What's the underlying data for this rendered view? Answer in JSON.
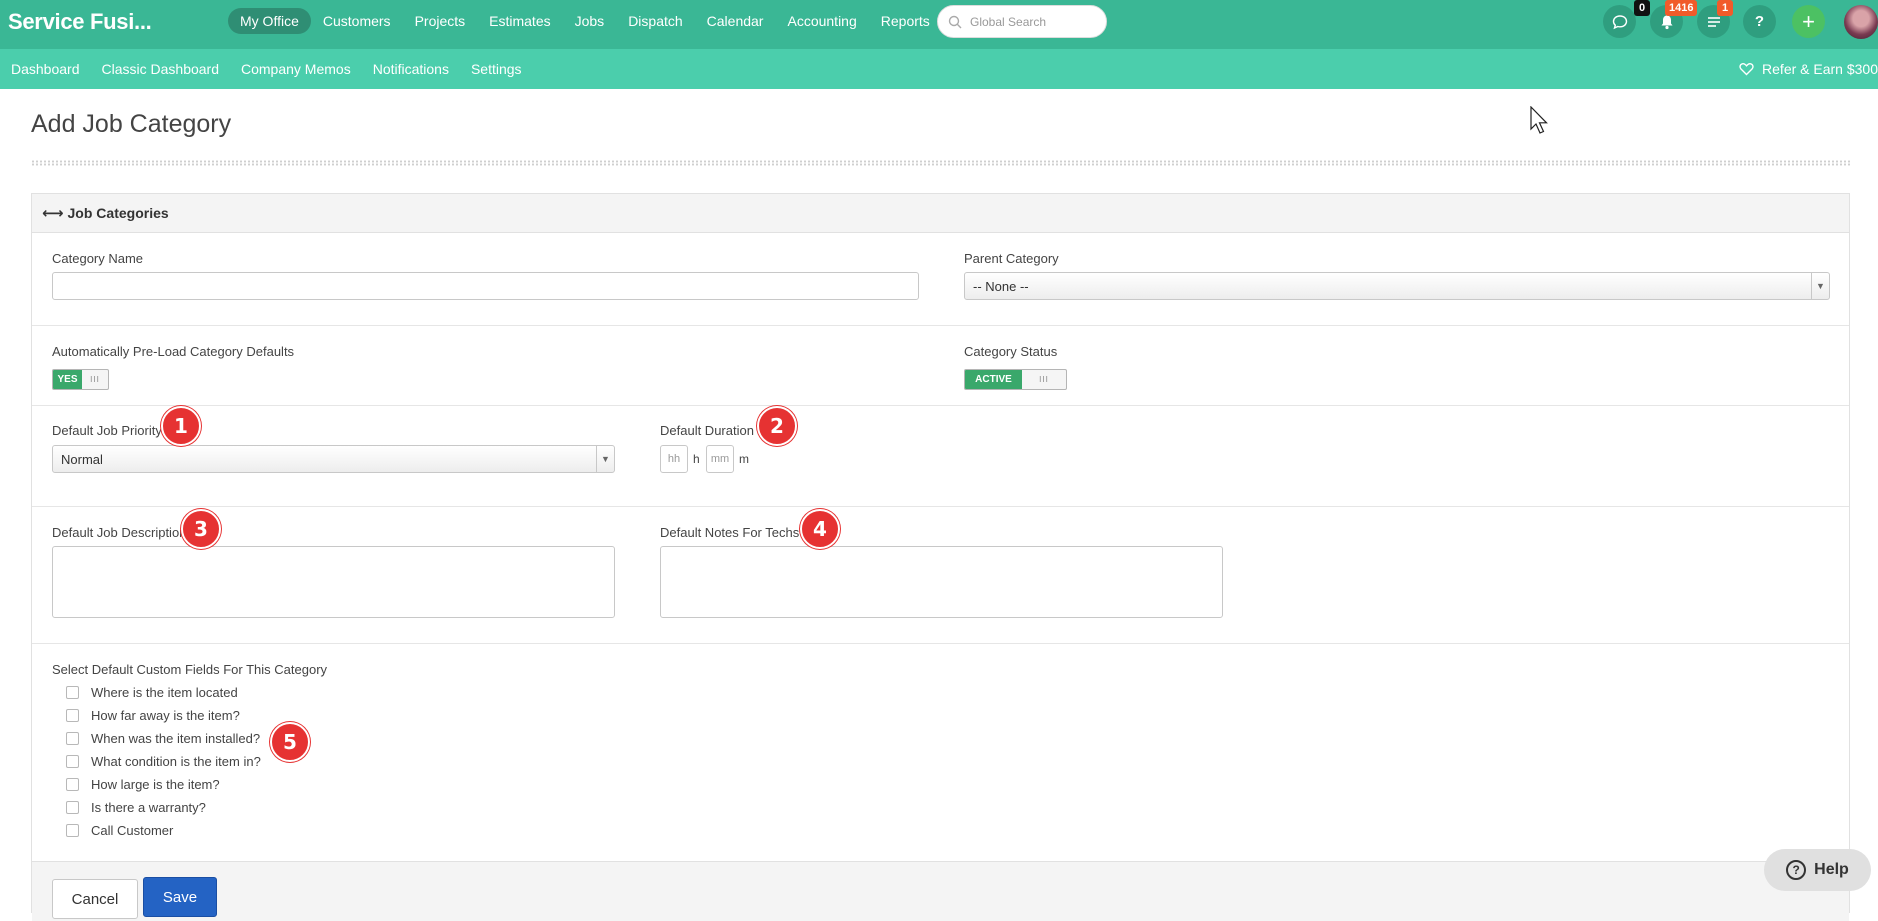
{
  "app": {
    "brand": "Service Fusi..."
  },
  "main_nav": [
    {
      "label": "My Office",
      "active": true
    },
    {
      "label": "Customers"
    },
    {
      "label": "Projects"
    },
    {
      "label": "Estimates"
    },
    {
      "label": "Jobs"
    },
    {
      "label": "Dispatch"
    },
    {
      "label": "Calendar"
    },
    {
      "label": "Accounting"
    },
    {
      "label": "Reports"
    }
  ],
  "search": {
    "placeholder": "Global Search"
  },
  "header_icons": {
    "chat_badge": "0",
    "notifications_badge": "1416",
    "tasks_badge": "1",
    "help_label": "?",
    "add_label": "+"
  },
  "sub_nav": [
    "Dashboard",
    "Classic Dashboard",
    "Company Memos",
    "Notifications",
    "Settings"
  ],
  "refer": {
    "label": "Refer & Earn $300"
  },
  "page": {
    "title": "Add Job Category"
  },
  "panel": {
    "title": "Job Categories",
    "category_name_label": "Category Name",
    "category_name_value": "",
    "parent_category_label": "Parent Category",
    "parent_category_value": "-- None --",
    "preload_label": "Automatically Pre-Load Category Defaults",
    "preload_toggle": "YES",
    "preload_handle": "III",
    "status_label": "Category Status",
    "status_toggle": "ACTIVE",
    "status_handle": "III",
    "priority_label": "Default Job Priority",
    "priority_value": "Normal",
    "duration_label": "Default Duration",
    "duration_hours_placeholder": "hh",
    "duration_hours_unit": "h",
    "duration_minutes_placeholder": "mm",
    "duration_minutes_unit": "m",
    "description_label": "Default Job Description",
    "notes_label": "Default Notes For Techs",
    "custom_fields_label": "Select Default Custom Fields For This Category",
    "custom_fields": [
      "Where is the item located",
      "How far away is the item?",
      "When was the item installed?",
      "What condition is the item in?",
      "How large is the item?",
      "Is there a warranty?",
      "Call Customer"
    ]
  },
  "markers": [
    "1",
    "2",
    "3",
    "4",
    "5"
  ],
  "buttons": {
    "cancel": "Cancel",
    "save": "Save"
  },
  "help": {
    "label": "Help",
    "icon": "?"
  },
  "colors": {
    "topbar": "#3ab795",
    "subbar": "#4bceac",
    "active_nav": "#2f8e74",
    "toggle_on": "#3aa86b",
    "save_button": "#2463c4",
    "marker": "#e63232",
    "badge_orange": "#f15b2a"
  }
}
